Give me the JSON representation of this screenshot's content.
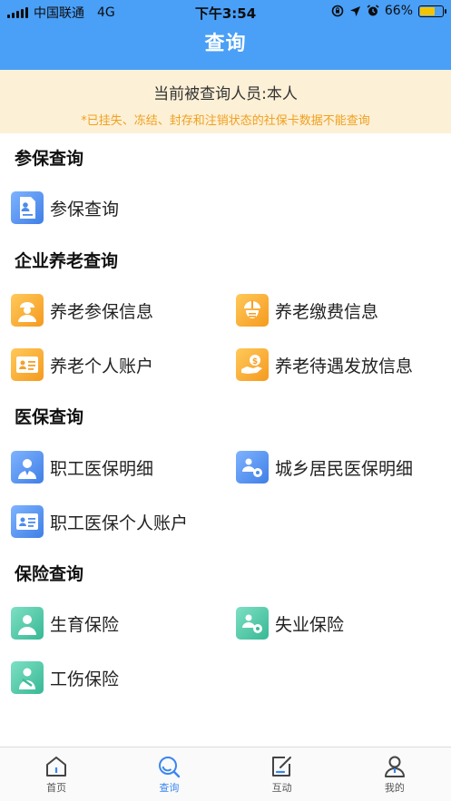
{
  "status": {
    "carrier": "中国联通",
    "network": "4G",
    "time": "下午3:54",
    "battery": "66%",
    "battery_level": 0.66
  },
  "header": {
    "title": "查询"
  },
  "notice": {
    "person": "当前被查询人员:本人",
    "warning": "*已挂失、冻结、封存和注销状态的社保卡数据不能查询"
  },
  "sections": {
    "insured": {
      "title": "参保查询",
      "items": [
        {
          "label": "参保查询",
          "icon": "id-form-icon"
        }
      ]
    },
    "pension": {
      "title": "企业养老查询",
      "items": [
        {
          "label": "养老参保信息",
          "icon": "worker-icon"
        },
        {
          "label": "养老缴费信息",
          "icon": "helmet-icon"
        },
        {
          "label": "养老个人账户",
          "icon": "id-card-icon"
        },
        {
          "label": "养老待遇发放信息",
          "icon": "hand-money-icon"
        }
      ]
    },
    "medical": {
      "title": "医保查询",
      "items": [
        {
          "label": "职工医保明细",
          "icon": "employee-icon"
        },
        {
          "label": "城乡居民医保明细",
          "icon": "residents-gear-icon"
        },
        {
          "label": "职工医保个人账户",
          "icon": "id-card-icon"
        }
      ]
    },
    "insurance": {
      "title": "保险查询",
      "items": [
        {
          "label": "生育保险",
          "icon": "person-icon"
        },
        {
          "label": "失业保险",
          "icon": "people-gear-icon"
        },
        {
          "label": "工伤保险",
          "icon": "injured-person-icon"
        }
      ]
    }
  },
  "tabs": [
    {
      "label": "首页",
      "icon": "home-icon",
      "active": false
    },
    {
      "label": "查询",
      "icon": "search-icon",
      "active": true
    },
    {
      "label": "互动",
      "icon": "edit-icon",
      "active": false
    },
    {
      "label": "我的",
      "icon": "user-icon",
      "active": false
    }
  ],
  "colors": {
    "primary": "#4a9ff7",
    "notice_bg": "#fcf0d6",
    "warning_text": "#f0a020",
    "active_tab": "#3a86f0"
  }
}
